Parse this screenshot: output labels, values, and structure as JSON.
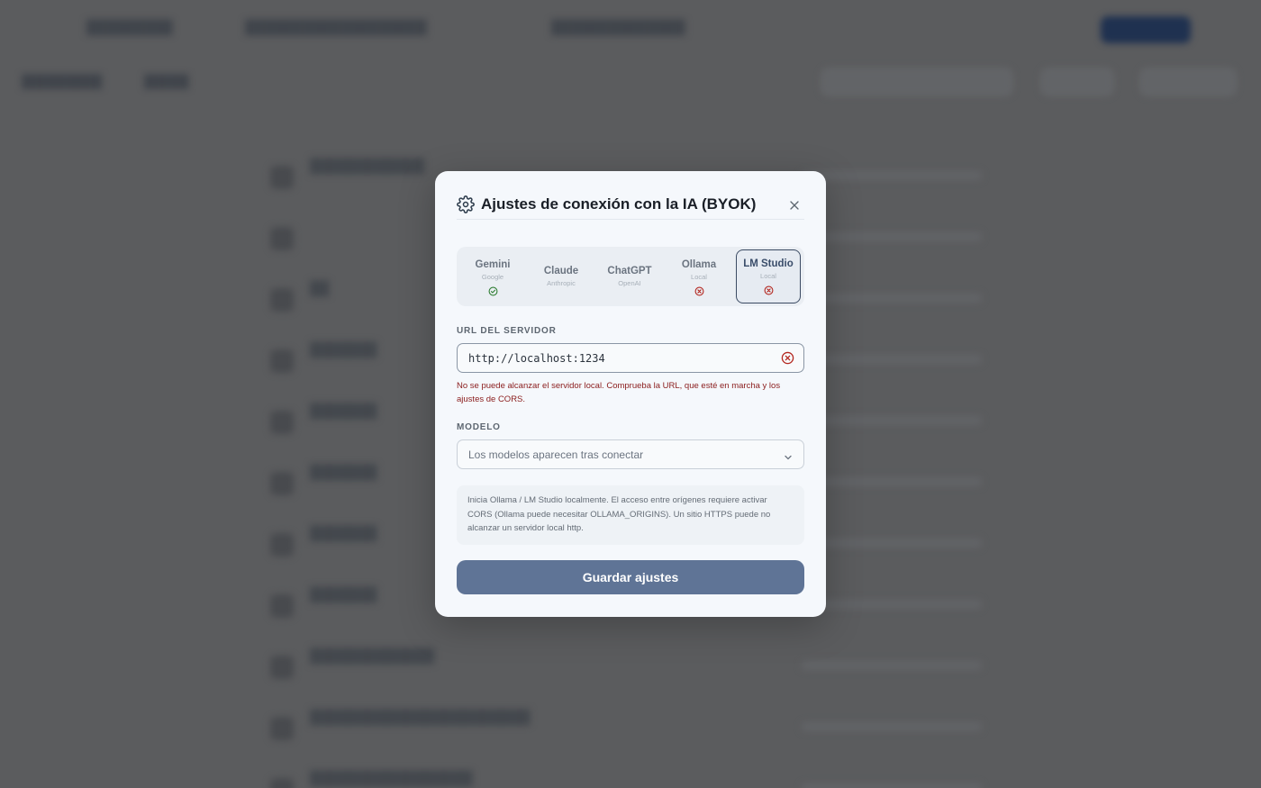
{
  "modal": {
    "title": "Ajustes de conexión con la IA (BYOK)",
    "providers": [
      {
        "name": "Gemini",
        "sub": "Google",
        "status": "connected"
      },
      {
        "name": "Claude",
        "sub": "Anthropic",
        "status": "none"
      },
      {
        "name": "ChatGPT",
        "sub": "OpenAI",
        "status": "none"
      },
      {
        "name": "Ollama",
        "sub": "Local",
        "status": "error"
      },
      {
        "name": "LM Studio",
        "sub": "Local",
        "status": "error",
        "active": true
      }
    ],
    "url_label": "URL DEL SERVIDOR",
    "url_value": "http://localhost:1234",
    "url_error": "No se puede alcanzar el servidor local. Comprueba la URL, que esté en marcha y los ajustes de CORS.",
    "model_label": "MODELO",
    "model_placeholder": "Los modelos aparecen tras conectar",
    "info": "Inicia Ollama / LM Studio localmente. El acceso entre orígenes requiere activar CORS (Ollama puede necesitar OLLAMA_ORIGINS). Un sitio HTTPS puede no alcanzar un servidor local http.",
    "save_label": "Guardar ajustes"
  },
  "colors": {
    "overlay": "#5b5c5e",
    "modal_bg": "#f5f8fc",
    "accent": "#5f7496",
    "active_border": "#3b4b63",
    "success": "#2e7d32",
    "error": "#b3261e",
    "error_text": "#8a1c1c"
  },
  "icons": {
    "header": "gear-icon",
    "close": "close-icon",
    "field_error": "error-circle-icon",
    "select": "chevron-down-icon",
    "status_ok": "check-circle-icon",
    "status_error": "x-circle-icon"
  }
}
